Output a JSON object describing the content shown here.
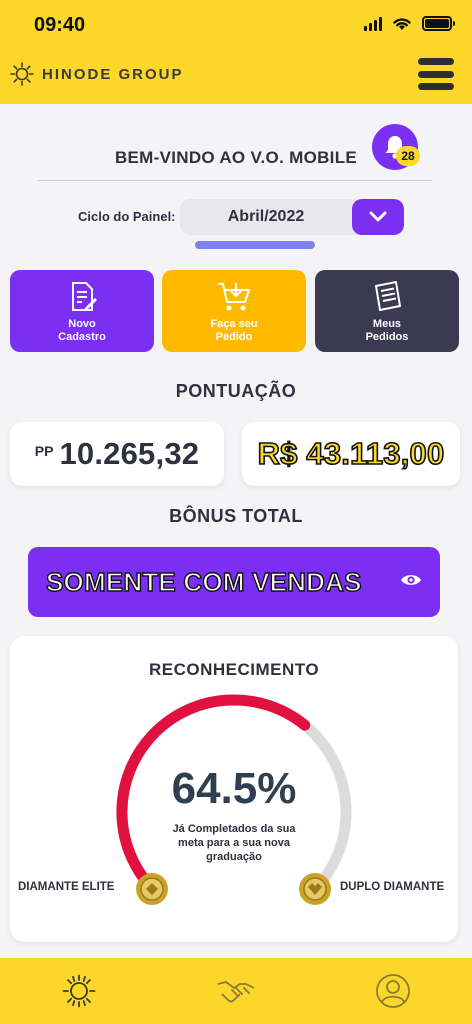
{
  "status": {
    "time": "09:40"
  },
  "header": {
    "brand": "HINODE GROUP"
  },
  "welcome": {
    "title": "BEM-VINDO AO V.O. MOBILE",
    "notifications": "28"
  },
  "cycle": {
    "label": "Ciclo do Painel:",
    "value": "Abril/2022"
  },
  "actions": [
    {
      "line1": "Novo",
      "line2": "Cadastro"
    },
    {
      "line1": "Faça seu",
      "line2": "Pedido"
    },
    {
      "line1": "Meus",
      "line2": "Pedidos"
    }
  ],
  "points": {
    "title": "PONTUAÇÃO",
    "pp_prefix": "PP",
    "pp_value": "10.265,32",
    "money_value": "R$ 43.113,00"
  },
  "bonus": {
    "title": "BÔNUS TOTAL",
    "value": "SOMENTE COM VENDAS"
  },
  "recognition": {
    "title": "RECONHECIMENTO",
    "percent": "64.5%",
    "progress": 0.645,
    "description": "Já Completados da sua meta para a sua nova graduação",
    "current_rank": "DIAMANTE ELITE",
    "next_rank": "DUPLO DIAMANTE"
  },
  "colors": {
    "brand_yellow": "#fcd72a",
    "purple": "#7b2ff2",
    "orange": "#ffba00",
    "dark": "#3b3a52",
    "gauge_red": "#e0103f"
  },
  "nav": {
    "items": [
      "sun-logo-icon",
      "handshake-icon",
      "user-icon"
    ]
  }
}
